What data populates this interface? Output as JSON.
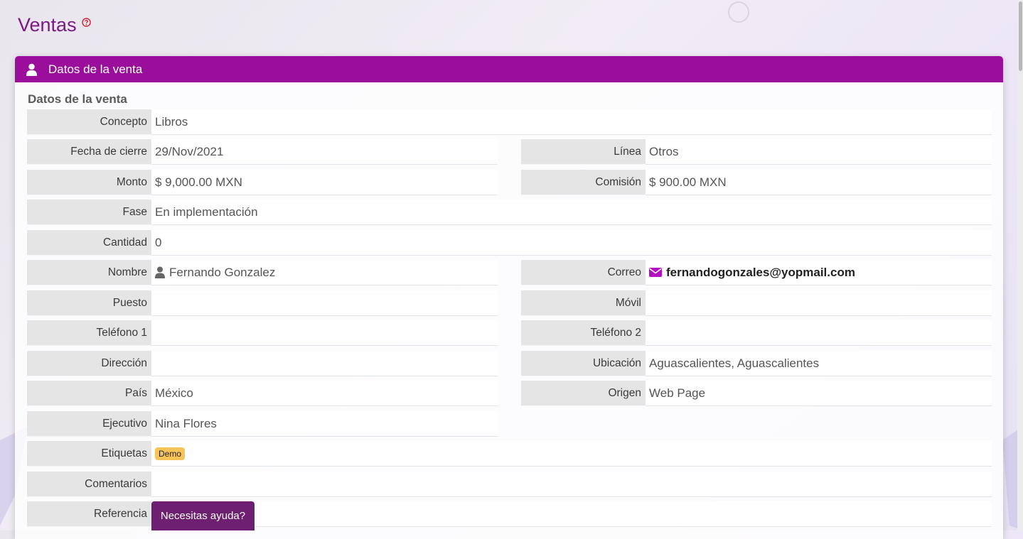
{
  "page": {
    "title": "Ventas"
  },
  "panel": {
    "header": "Datos de la venta",
    "section_title": "Datos de la venta"
  },
  "fields": {
    "concepto": {
      "label": "Concepto",
      "value": "Libros"
    },
    "fecha_cierre": {
      "label": "Fecha de cierre",
      "value": "29/Nov/2021"
    },
    "linea": {
      "label": "Línea",
      "value": "Otros"
    },
    "monto": {
      "label": "Monto",
      "value": "$ 9,000.00 MXN"
    },
    "comision": {
      "label": "Comisión",
      "value": "$ 900.00 MXN"
    },
    "fase": {
      "label": "Fase",
      "value": "En implementación"
    },
    "cantidad": {
      "label": "Cantidad",
      "value": "0"
    },
    "nombre": {
      "label": "Nombre",
      "value": "Fernando Gonzalez"
    },
    "correo": {
      "label": "Correo",
      "value": "fernandogonzales@yopmail.com"
    },
    "puesto": {
      "label": "Puesto",
      "value": ""
    },
    "movil": {
      "label": "Móvil",
      "value": ""
    },
    "telefono1": {
      "label": "Teléfono 1",
      "value": ""
    },
    "telefono2": {
      "label": "Teléfono 2",
      "value": ""
    },
    "direccion": {
      "label": "Dirección",
      "value": ""
    },
    "ubicacion": {
      "label": "Ubicación",
      "value": "Aguascalientes, Aguascalientes"
    },
    "pais": {
      "label": "País",
      "value": "México"
    },
    "origen": {
      "label": "Origen",
      "value": "Web Page"
    },
    "ejecutivo": {
      "label": "Ejecutivo",
      "value": "Nina Flores"
    },
    "etiquetas": {
      "label": "Etiquetas",
      "badge": "Demo"
    },
    "comentarios": {
      "label": "Comentarios",
      "value": ""
    },
    "referencia": {
      "label": "Referencia",
      "value": ""
    }
  },
  "help_button": {
    "label": "Necesitas ayuda?"
  },
  "colors": {
    "accent": "#9b0e9b",
    "title": "#7b1a86",
    "badge": "#f7c45a",
    "help_button": "#6e1f72"
  },
  "icons": {
    "help": "question-circle-icon",
    "header": "user-icon",
    "contact": "user-icon",
    "email": "envelope-icon"
  }
}
